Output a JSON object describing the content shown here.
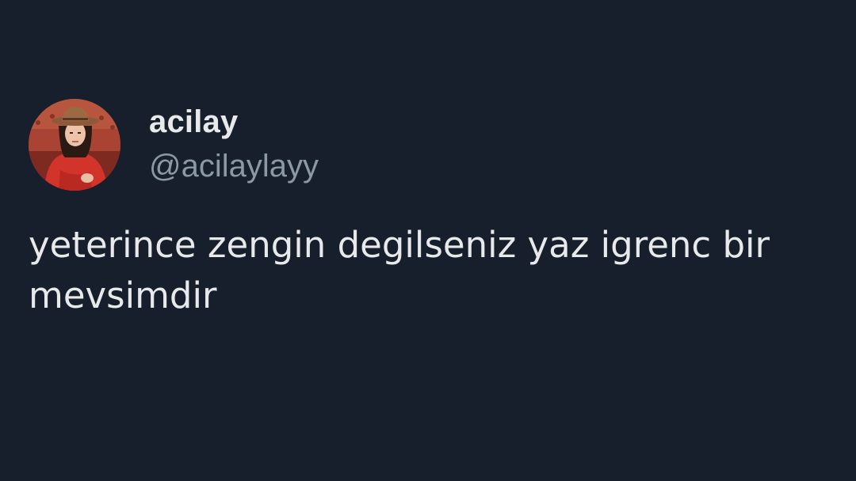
{
  "tweet": {
    "author": {
      "display_name": "acilay",
      "handle": "@acilaylayy",
      "avatar_icon": "profile-photo"
    },
    "text": "yeterince zengin degilseniz yaz igrenc bir mevsimdir"
  },
  "colors": {
    "background": "#161f2b",
    "primary_text": "#e7e9ea",
    "secondary_text": "#8b98a5"
  }
}
